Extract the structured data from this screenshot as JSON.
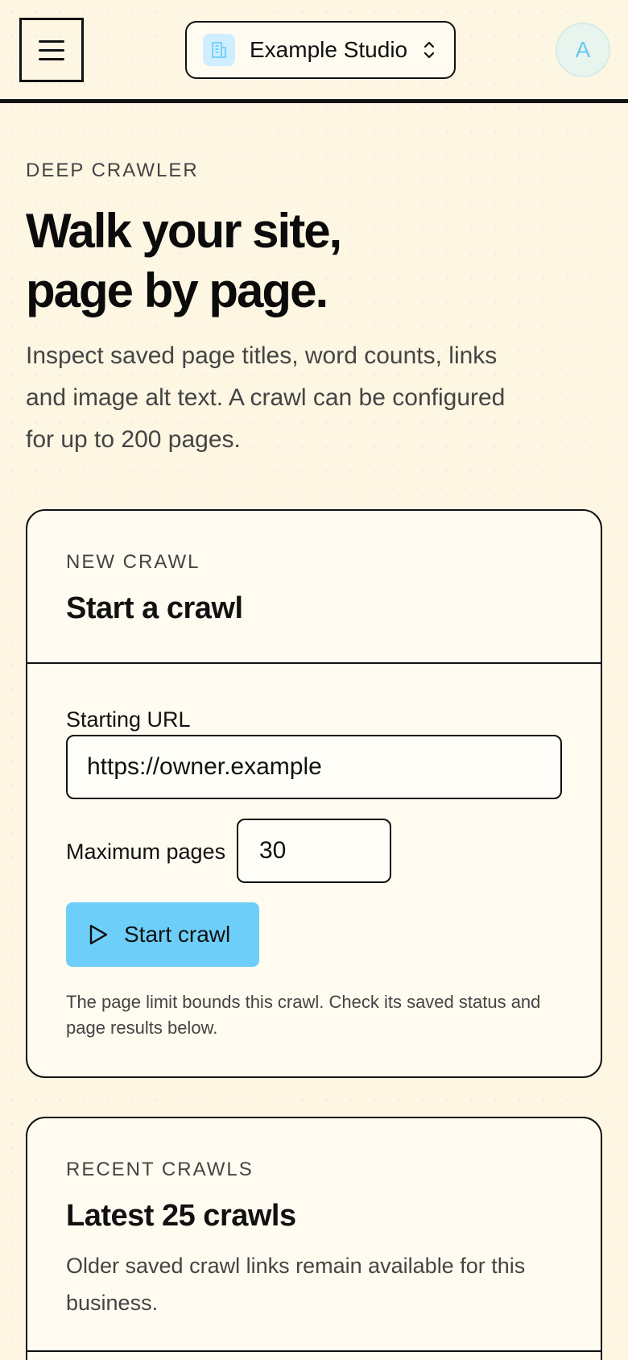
{
  "header": {
    "workspace_name": "Example Studio",
    "avatar_initial": "A"
  },
  "hero": {
    "eyebrow": "DEEP CRAWLER",
    "title_line1": "Walk your site,",
    "title_line2": "page by page.",
    "subtitle": "Inspect saved page titles, word counts, links and image alt text. A crawl can be configured for up to 200 pages."
  },
  "new_crawl": {
    "eyebrow": "NEW CRAWL",
    "title": "Start a crawl",
    "url_label": "Starting URL",
    "url_value": "https://owner.example",
    "max_pages_label": "Maximum pages",
    "max_pages_value": "30",
    "start_button_label": "Start crawl",
    "help_text": "The page limit bounds this crawl. Check its saved status and page results below."
  },
  "recent_crawls": {
    "eyebrow": "RECENT CRAWLS",
    "title": "Latest 25 crawls",
    "description": "Older saved crawl links remain available for this business."
  },
  "colors": {
    "background": "#fdf6e3",
    "accent_button": "#6dcff9",
    "avatar_text": "#6cc9f0",
    "workspace_icon_bg": "#cfeeff"
  },
  "icons": {
    "menu": "hamburger-menu-icon",
    "workspace": "building-icon",
    "switcher": "chevron-up-down-icon",
    "start": "play-icon"
  }
}
